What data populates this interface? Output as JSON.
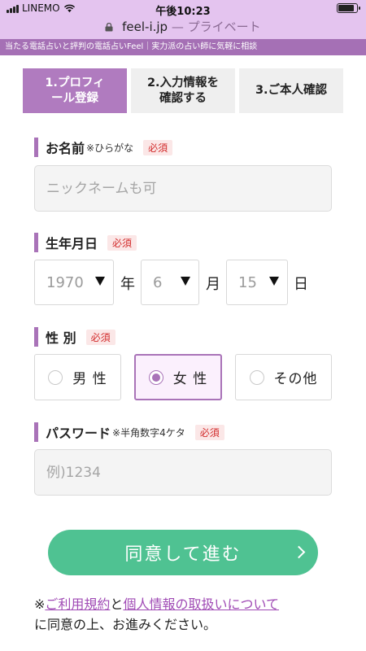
{
  "status_bar": {
    "carrier": "LINEMO",
    "time": "午後10:23",
    "battery_level": 0.9
  },
  "url_bar": {
    "domain": "feel-i.jp",
    "private_label": "— プライベート"
  },
  "tagline": "当たる電話占いと評判の電話占いFeel｜実力派の占い師に気軽に相談",
  "steps": [
    {
      "label": "1.プロフィ\nール登録",
      "active": true
    },
    {
      "label": "2.入力情報を\n確認する",
      "active": false
    },
    {
      "label": "3.ご本人確認",
      "active": false
    }
  ],
  "form": {
    "name_field": {
      "label": "お名前",
      "note": "※ひらがな",
      "required": "必須",
      "placeholder": "ニックネームも可",
      "value": ""
    },
    "birthdate": {
      "label": "生年月日",
      "required": "必須",
      "year": "1970",
      "year_unit": "年",
      "month": "6",
      "month_unit": "月",
      "day": "15",
      "day_unit": "日"
    },
    "gender": {
      "label": "性 別",
      "required": "必須",
      "options": [
        "男 性",
        "女 性",
        "その他"
      ],
      "selected": "女 性"
    },
    "password": {
      "label": "パスワード",
      "note": "※半角数字4ケタ",
      "required": "必須",
      "placeholder": "例)1234",
      "value": ""
    }
  },
  "submit": {
    "label": "同意して進む"
  },
  "agreement": {
    "prefix": "※",
    "terms_link": "ご利用規約",
    "and": "と",
    "privacy_link": "個人情報の取扱いについて",
    "suffix": "に同意の上、お進みください。"
  },
  "colors": {
    "accent": "#a973b8",
    "required": "#d22b2b",
    "submit": "#4fc292",
    "header": "#e4c4ef"
  }
}
